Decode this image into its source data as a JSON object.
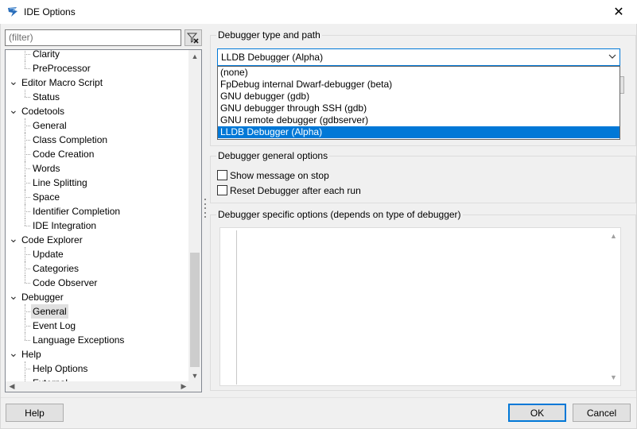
{
  "window": {
    "title": "IDE Options",
    "close_glyph": "✕",
    "accent": "#0078d7"
  },
  "filter": {
    "placeholder": "(filter)"
  },
  "tree": {
    "items": [
      {
        "label": "Clarity",
        "level": 2
      },
      {
        "label": "PreProcessor",
        "level": 2
      },
      {
        "label": "Editor Macro Script",
        "level": 1,
        "expanded": true
      },
      {
        "label": "Status",
        "level": 2
      },
      {
        "label": "Codetools",
        "level": 1,
        "expanded": true
      },
      {
        "label": "General",
        "level": 2
      },
      {
        "label": "Class Completion",
        "level": 2
      },
      {
        "label": "Code Creation",
        "level": 2
      },
      {
        "label": "Words",
        "level": 2
      },
      {
        "label": "Line Splitting",
        "level": 2
      },
      {
        "label": "Space",
        "level": 2
      },
      {
        "label": "Identifier Completion",
        "level": 2
      },
      {
        "label": "IDE Integration",
        "level": 2
      },
      {
        "label": "Code Explorer",
        "level": 1,
        "expanded": true
      },
      {
        "label": "Update",
        "level": 2
      },
      {
        "label": "Categories",
        "level": 2
      },
      {
        "label": "Code Observer",
        "level": 2
      },
      {
        "label": "Debugger",
        "level": 1,
        "expanded": true
      },
      {
        "label": "General",
        "level": 2,
        "selected": true
      },
      {
        "label": "Event Log",
        "level": 2
      },
      {
        "label": "Language Exceptions",
        "level": 2
      },
      {
        "label": "Help",
        "level": 1,
        "expanded": true
      },
      {
        "label": "Help Options",
        "level": 2
      },
      {
        "label": "External",
        "level": 2
      }
    ]
  },
  "debugger_type": {
    "group_title": "Debugger type and path",
    "selected": "LLDB Debugger (Alpha)",
    "options": [
      "(none)",
      "FpDebug internal Dwarf-debugger (beta)",
      "GNU debugger (gdb)",
      "GNU debugger through SSH (gdb)",
      "GNU remote debugger (gdbserver)",
      "LLDB Debugger (Alpha)"
    ]
  },
  "general_options": {
    "group_title": "Debugger general options",
    "show_message_on_stop": "Show message on stop",
    "reset_debugger": "Reset Debugger after each run"
  },
  "specific_options": {
    "group_title": "Debugger specific options (depends on type of debugger)"
  },
  "buttons": {
    "help": "Help",
    "ok": "OK",
    "cancel": "Cancel"
  }
}
